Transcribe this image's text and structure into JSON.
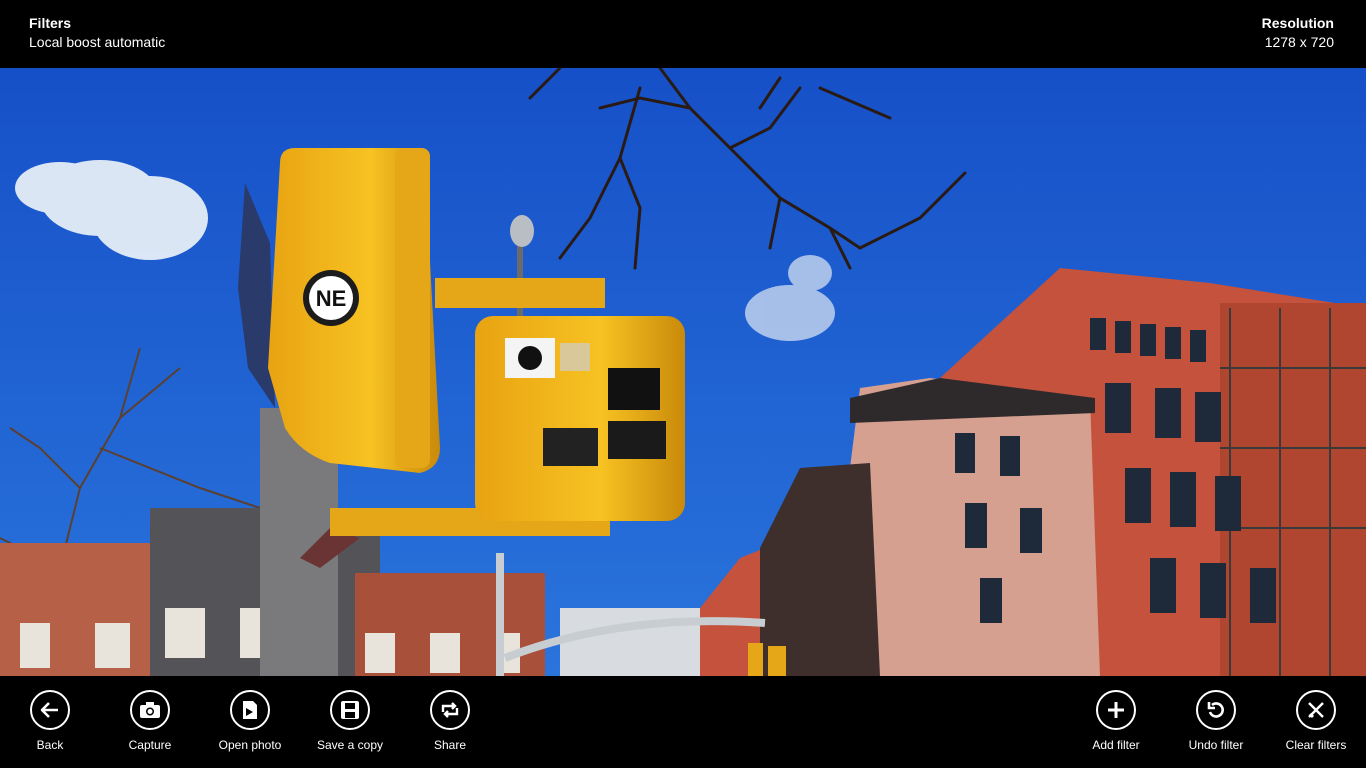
{
  "header": {
    "left_title": "Filters",
    "left_subtitle": "Local boost automatic",
    "right_title": "Resolution",
    "right_subtitle": "1278 x 720"
  },
  "photo": {
    "sticker_text": "NE"
  },
  "appbar": {
    "left_commands": [
      {
        "label": "Back",
        "icon": "back-arrow-icon"
      },
      {
        "label": "Capture",
        "icon": "camera-icon"
      },
      {
        "label": "Open photo",
        "icon": "open-photo-icon"
      },
      {
        "label": "Save a copy",
        "icon": "save-icon"
      },
      {
        "label": "Share",
        "icon": "share-icon"
      }
    ],
    "right_commands": [
      {
        "label": "Add filter",
        "icon": "plus-icon"
      },
      {
        "label": "Undo filter",
        "icon": "undo-icon"
      },
      {
        "label": "Clear filters",
        "icon": "clear-icon"
      }
    ]
  },
  "colors": {
    "background": "#000000",
    "sky": "#1b5fd0",
    "signal_yellow": "#f2b418",
    "brick": "#b8543c"
  }
}
